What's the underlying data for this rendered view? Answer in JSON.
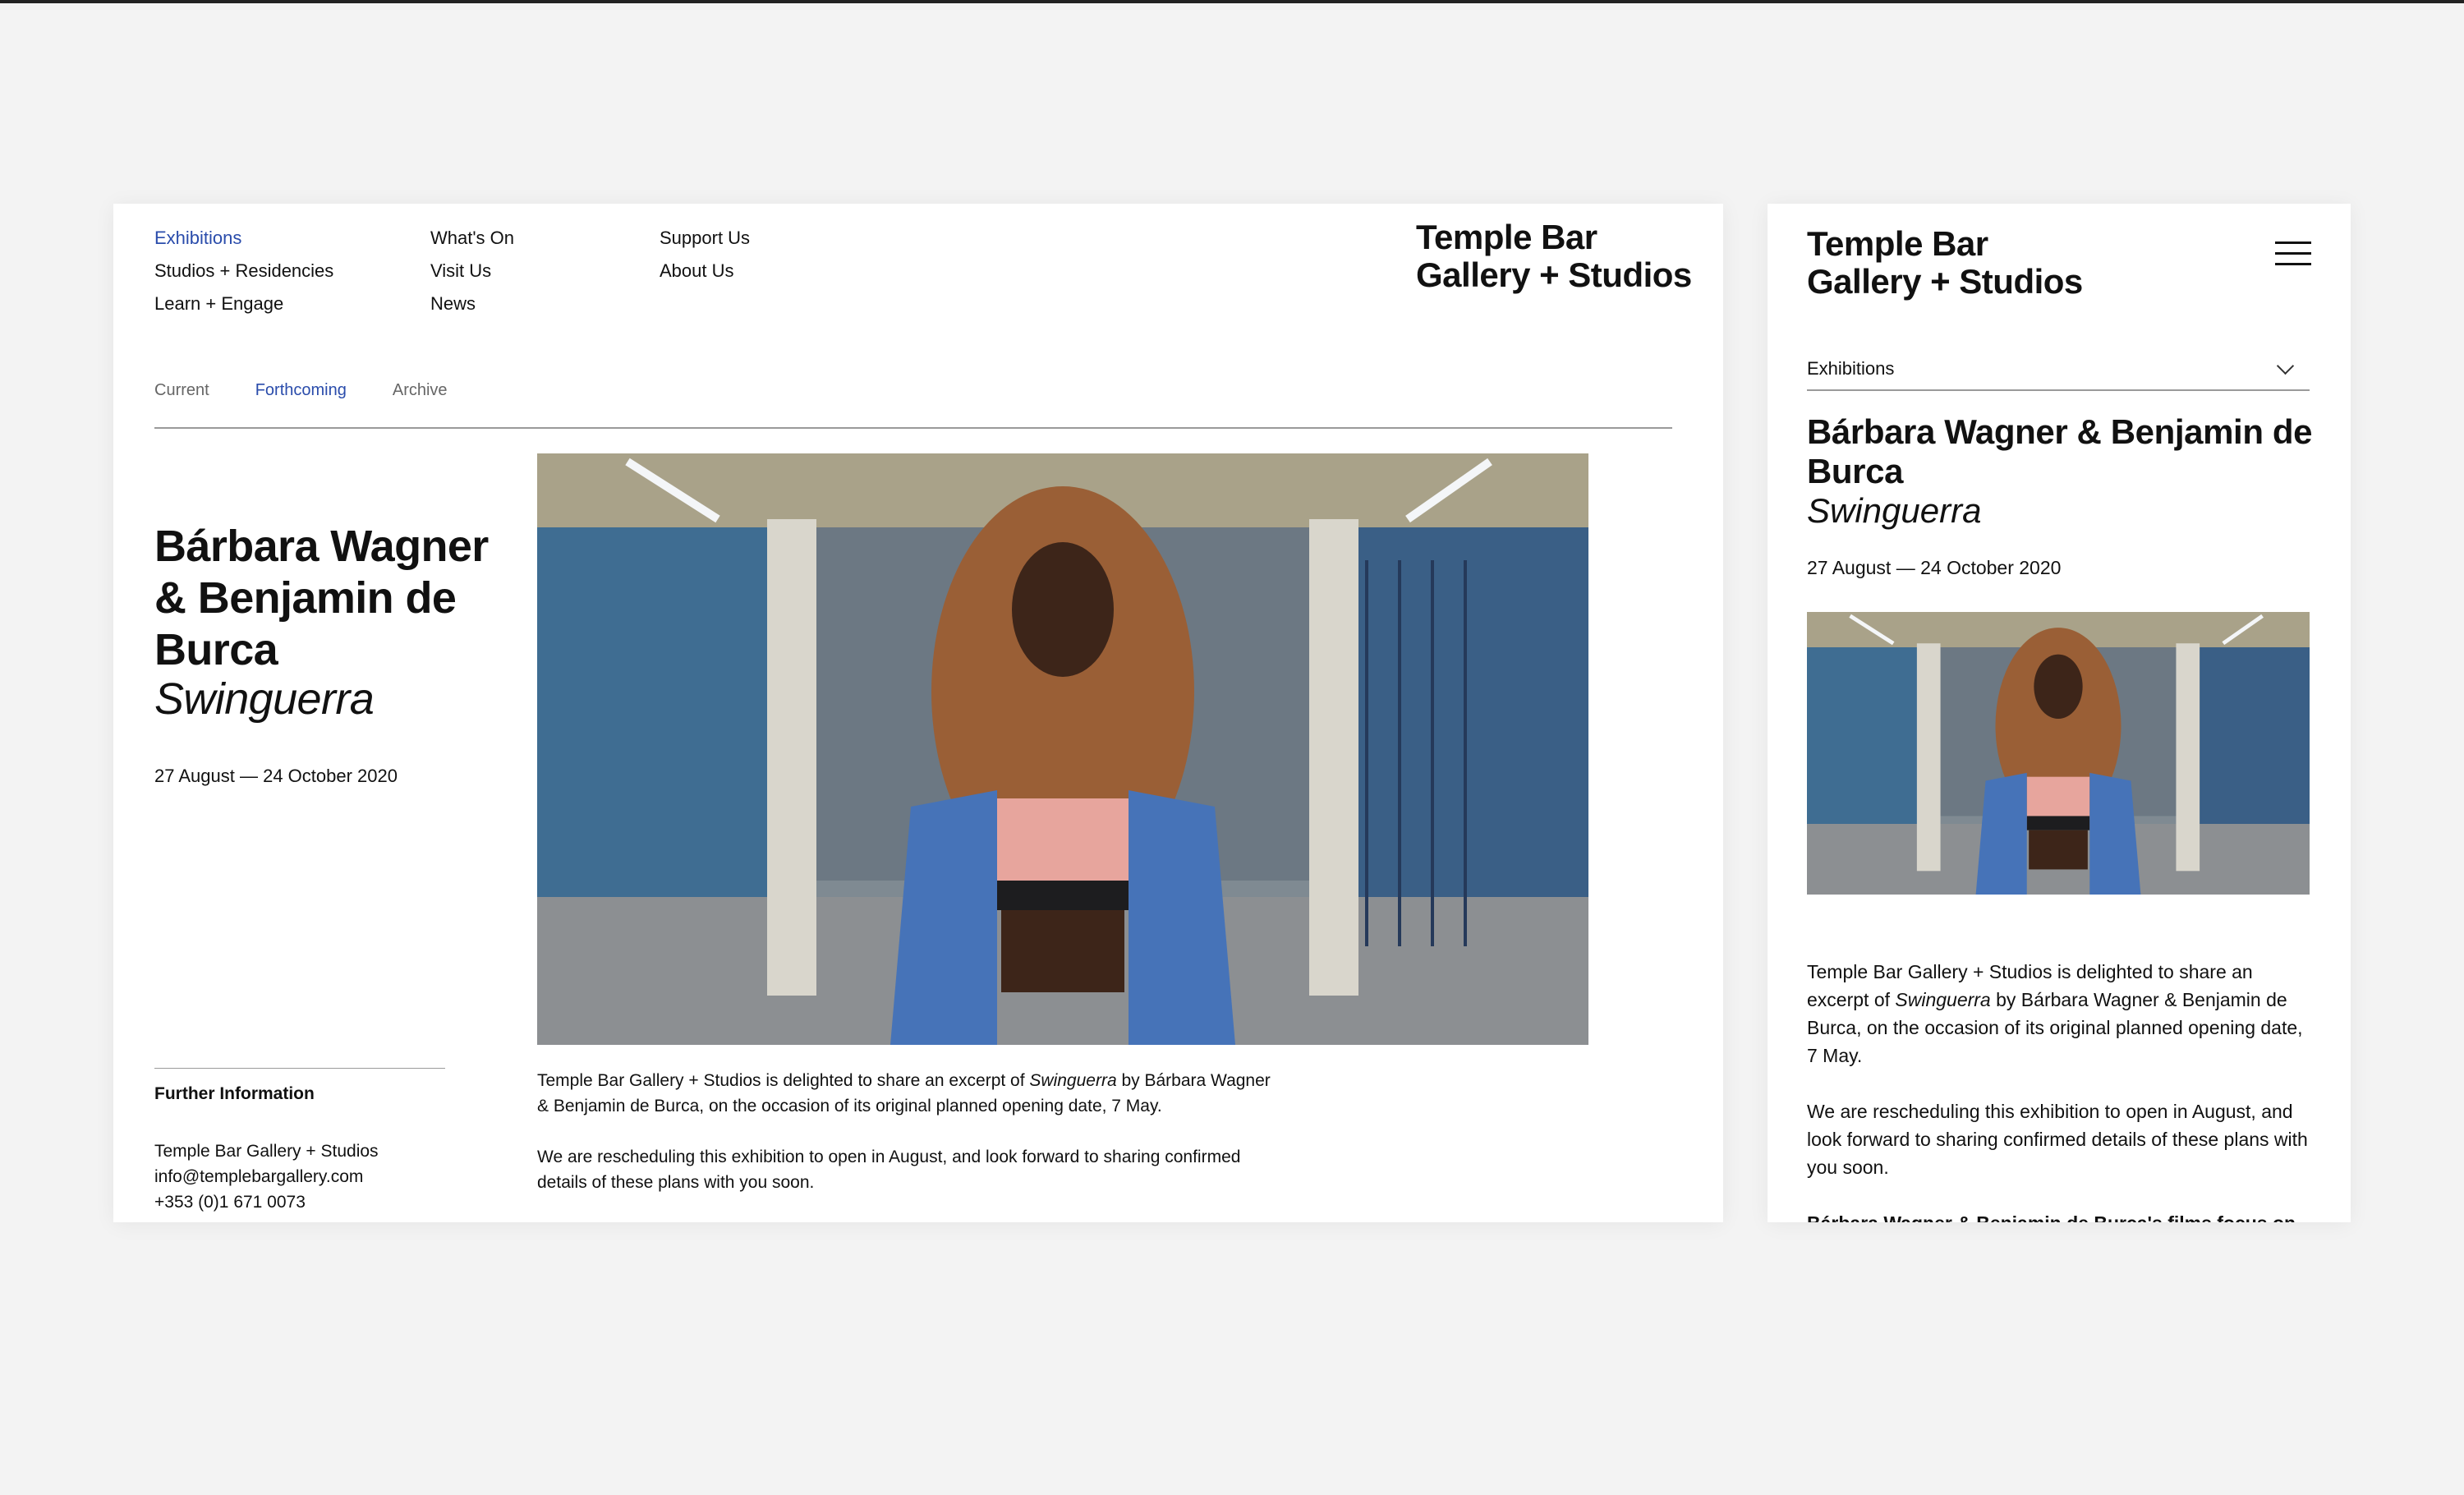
{
  "nav": {
    "col1": [
      "Exhibitions",
      "Studios + Residencies",
      "Learn + Engage"
    ],
    "col2": [
      "What's On",
      "Visit Us",
      "News"
    ],
    "col3": [
      "Support Us",
      "About Us"
    ]
  },
  "logo": {
    "line1": "Temple Bar",
    "line2": "Gallery + Studios"
  },
  "subtabs": [
    "Current",
    "Forthcoming",
    "Archive"
  ],
  "exhibition": {
    "artists": "Bárbara Wagner & Benjamin de Burca",
    "title": "Swinguerra",
    "dates": "27 August — 24 October 2020"
  },
  "further_info": {
    "heading": "Further Information",
    "org": "Temple Bar Gallery + Studios",
    "email": "info@templebargallery.com",
    "phone": "+353 (0)1 671 0073"
  },
  "body": {
    "p1_before": "Temple Bar Gallery + Studios is delighted to share an excerpt of ",
    "p1_em": "Swinguerra",
    "p1_after": " by Bárbara Wagner & Benjamin de Burca, on the occasion of its original planned opening date, 7 May.",
    "p2": "We are rescheduling this exhibition to open in August, and look forward to sharing confirmed details of these plans with you soon.",
    "p3_cut": "Bárbara Wagner & Benjamin de Burca's films focus on"
  },
  "mobile": {
    "dropdown_label": "Exhibitions"
  },
  "icons": {
    "menu": "hamburger-icon",
    "dropdown": "chevron-down-icon"
  },
  "colors": {
    "accent": "#2a4cab",
    "background": "#f3f3f3"
  }
}
